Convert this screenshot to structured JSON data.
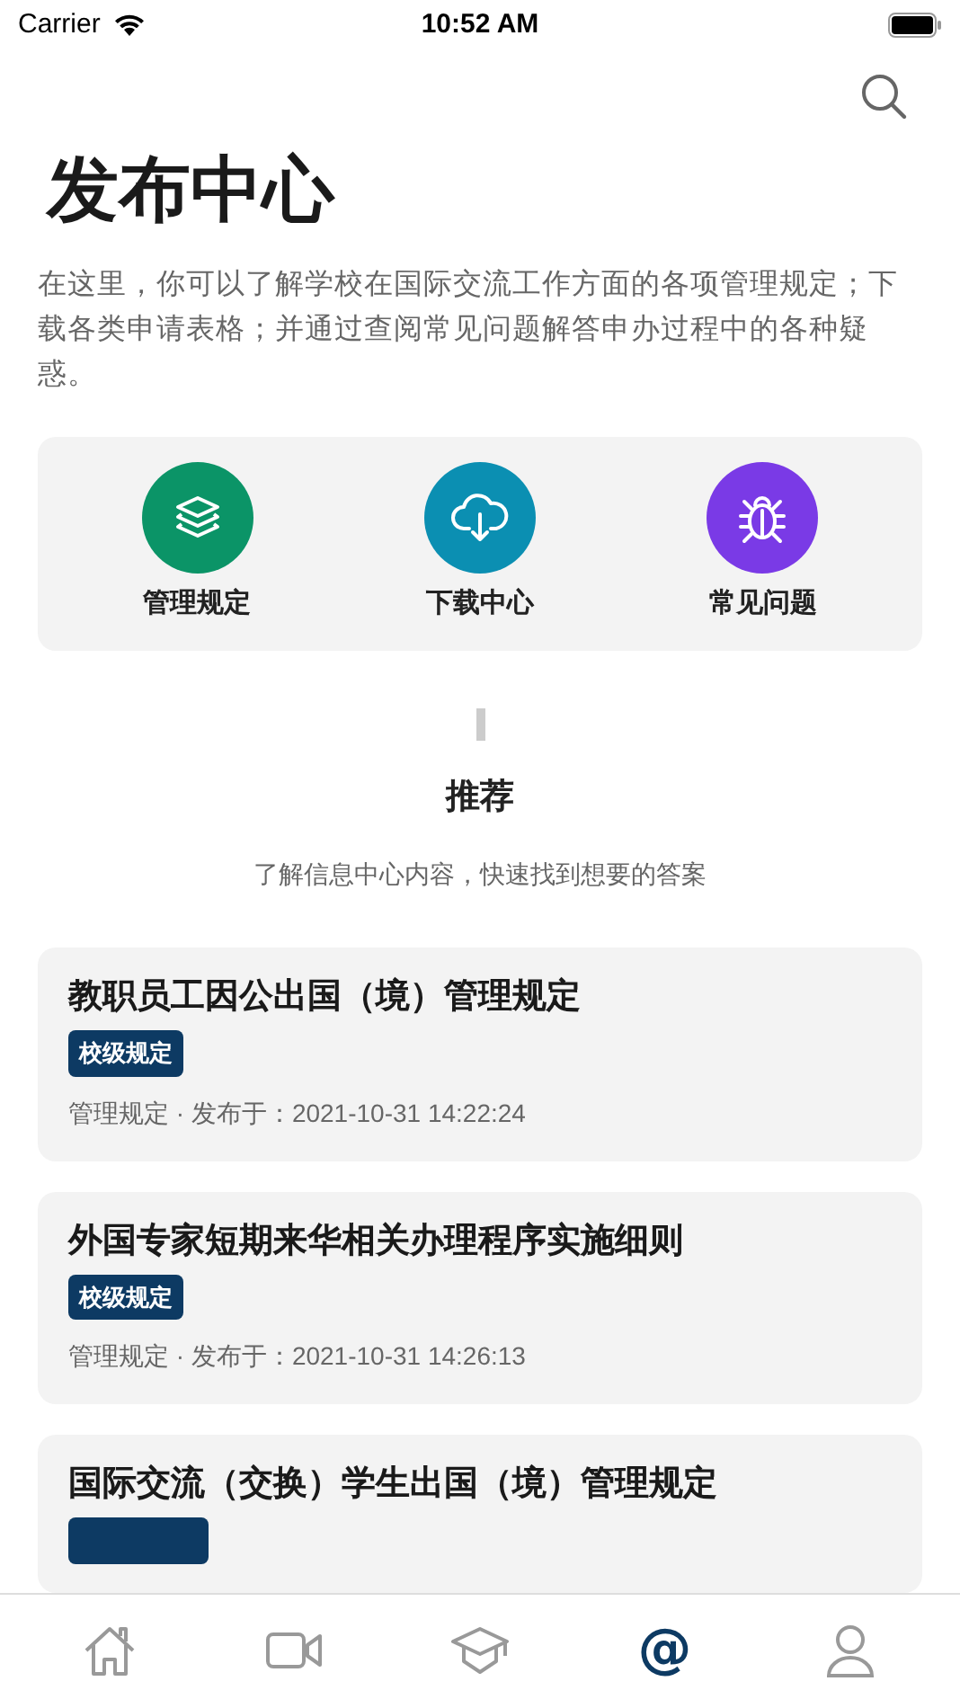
{
  "status_bar": {
    "carrier": "Carrier",
    "time": "10:52 AM"
  },
  "title": "发布中心",
  "description": "在这里，你可以了解学校在国际交流工作方面的各项管理规定；下载各类申请表格；并通过查阅常见问题解答申办过程中的各种疑惑。",
  "shortcuts": [
    {
      "kind": "layers",
      "label": "管理规定",
      "color": "#0b9467"
    },
    {
      "kind": "download",
      "label": "下载中心",
      "color": "#0b8fb2"
    },
    {
      "kind": "bug",
      "label": "常见问题",
      "color": "#7a3ae6"
    }
  ],
  "section": {
    "title": "推荐",
    "subtitle": "了解信息中心内容，快速找到想要的答案"
  },
  "articles": [
    {
      "title": "教职员工因公出国（境）管理规定",
      "tag": "校级规定",
      "meta": "管理规定 · 发布于：2021-10-31 14:22:24"
    },
    {
      "title": "外国专家短期来华相关办理程序实施细则",
      "tag": "校级规定",
      "meta": "管理规定 · 发布于：2021-10-31 14:26:13"
    },
    {
      "title": "国际交流（交换）学生出国（境）管理规定",
      "tag_cut": true
    }
  ],
  "tab_bar": [
    {
      "kind": "home",
      "selected": false
    },
    {
      "kind": "video",
      "selected": false
    },
    {
      "kind": "cap",
      "selected": false
    },
    {
      "kind": "at",
      "glyph": "@",
      "selected": true
    },
    {
      "kind": "person",
      "selected": false
    }
  ]
}
